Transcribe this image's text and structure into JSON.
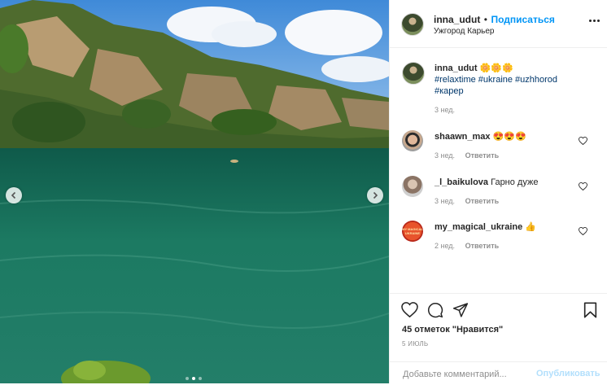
{
  "post": {
    "username": "inna_udut",
    "separator": "•",
    "follow_label": "Подписаться",
    "location": "Ужгород Карьер"
  },
  "caption": {
    "username": "inna_udut",
    "emoji": "🌼🌼🌼",
    "tags": "#relaxtime #ukraine #uzhhorod",
    "tags2": "#карер",
    "time": "3 нед."
  },
  "comments": [
    {
      "username": "shaawn_max",
      "text": "😍😍😍",
      "time": "3 нед.",
      "reply": "Ответить"
    },
    {
      "username": "_l_baikulova",
      "text": "Гарно дуже",
      "time": "3 нед.",
      "reply": "Ответить"
    },
    {
      "username": "my_magical_ukraine",
      "text": "👍",
      "time": "2 нед.",
      "reply": "Ответить"
    }
  ],
  "magical_avatar_text": "MY MAGICAL UKRAINE",
  "actions": {
    "likes": "45 отметок \"Нравится\"",
    "date": "5 ИЮЛЬ",
    "comment_placeholder": "Добавьте комментарий...",
    "publish_label": "Опубликовать"
  },
  "icons": {
    "prev": "chevron-left-icon",
    "next": "chevron-right-icon",
    "more": "more-horizontal-icon",
    "heart": "heart-icon",
    "comment": "comment-icon",
    "share": "share-icon",
    "save": "bookmark-icon"
  },
  "carousel": {
    "slides": 3,
    "active": 1
  },
  "colors": {
    "accent": "#0095f6",
    "publish_disabled": "#b2dffc",
    "muted": "#8e8e8e"
  }
}
